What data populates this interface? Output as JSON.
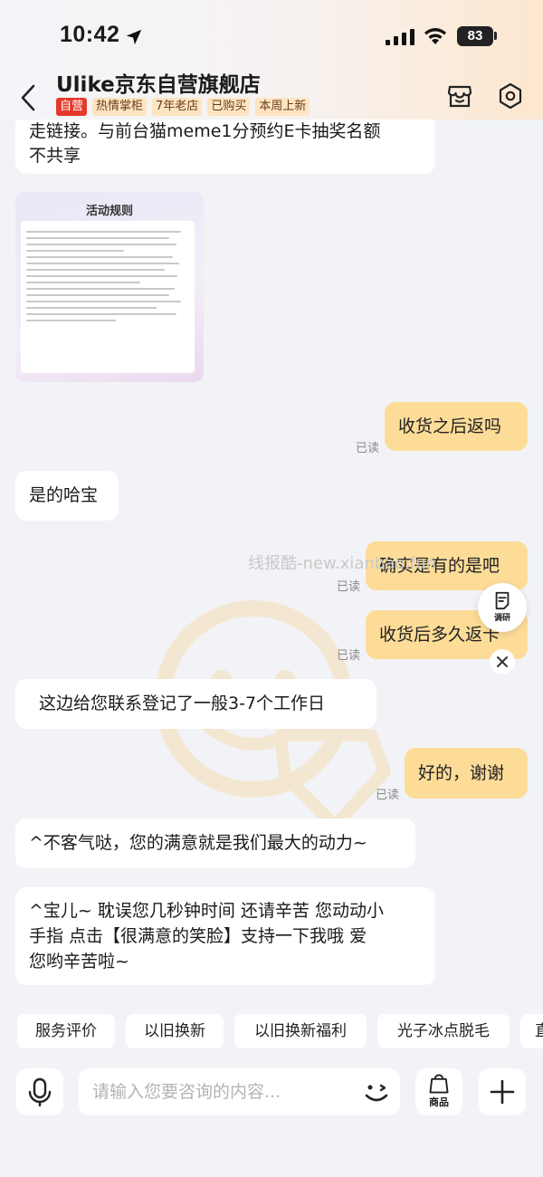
{
  "status_bar": {
    "time": "10:42",
    "battery": "83"
  },
  "header": {
    "store_name": "Ulike京东自营旗舰店",
    "tags": [
      "自营",
      "热情掌柜",
      "7年老店",
      "已购买",
      "本周上新"
    ]
  },
  "messages": {
    "m0_line1": "走链接。与前台猫meme1分预约E卡抽奖名额",
    "m0_line2": "不共享",
    "rule_image_title": "活动规则",
    "m1": "收货之后返吗",
    "m1_status": "已读",
    "m2": "是的哈宝",
    "m3": "确实是有的是吧",
    "m3_status": "已读",
    "m4": "收货后多久返卡",
    "m4_status": "已读",
    "m5": "这边给您联系登记了一般3-7个工作日",
    "m6": "好的，谢谢",
    "m6_status": "已读",
    "m7": "^不客气哒，您的满意就是我们最大的动力~",
    "m8_line1": "^宝儿~ 耽误您几秒钟时间 还请辛苦 您动动小",
    "m8_line2": "手指 点击【很满意的笑脸】支持一下我哦  爱",
    "m8_line3": "您哟辛苦啦~"
  },
  "watermark": "线报酷-new.xianbao.fun",
  "survey": {
    "label": "调研"
  },
  "quick_replies": [
    "服务评价",
    "以旧换新",
    "以旧换新福利",
    "光子冰点脱毛",
    "直"
  ],
  "input": {
    "placeholder": "请输入您要咨询的内容..."
  },
  "goods_button": {
    "label": "商品"
  },
  "colors": {
    "accent": "#e4392a",
    "my_bubble": "#fddc98",
    "tag_bg": "#fde5c4"
  }
}
